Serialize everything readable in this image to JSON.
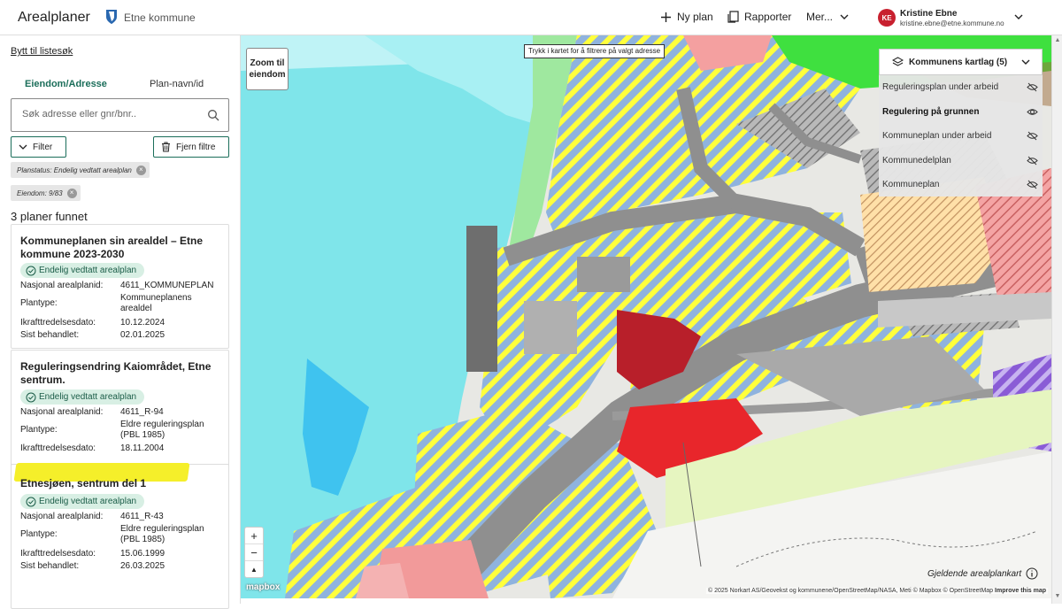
{
  "header": {
    "app_title": "Arealplaner",
    "municipality": "Etne kommune",
    "new_plan_label": "Ny plan",
    "reports_label": "Rapporter",
    "more_label": "Mer...",
    "user": {
      "initials": "KE",
      "name": "Kristine Ebne",
      "email": "kristine.ebne@etne.kommune.no"
    }
  },
  "sidebar": {
    "switch_link": "Bytt til listesøk",
    "tabs": [
      {
        "label": "Eiendom/Adresse",
        "active": true
      },
      {
        "label": "Plan-navn/id",
        "active": false
      }
    ],
    "search_placeholder": "Søk adresse eller gnr/bnr..",
    "filter_label": "Filter",
    "clear_filter_label": "Fjern filtre",
    "chips": [
      "Planstatus: Endelig vedtatt arealplan",
      "Eiendom: 9/83"
    ],
    "result_count": "3 planer funnet",
    "plans": [
      {
        "title": "Kommuneplanen sin arealdel – Etne kommune 2023-2030",
        "status": "Endelig vedtatt arealplan",
        "fields": [
          {
            "key": "Nasjonal arealplanid:",
            "value": "4611_KOMMUNEPLAN"
          },
          {
            "key": "Plantype:",
            "value": "Kommuneplanens arealdel"
          },
          {
            "key": "Ikrafttredelsesdato:",
            "value": "10.12.2024"
          },
          {
            "key": "Sist behandlet:",
            "value": "02.01.2025"
          }
        ]
      },
      {
        "title": "Reguleringsendring Kaiområdet, Etne sentrum.",
        "status": "Endelig vedtatt arealplan",
        "fields": [
          {
            "key": "Nasjonal arealplanid:",
            "value": "4611_R-94"
          },
          {
            "key": "Plantype:",
            "value": "Eldre reguleringsplan (PBL 1985)"
          },
          {
            "key": "Ikrafttredelsesdato:",
            "value": "18.11.2004"
          }
        ]
      },
      {
        "title": "Etnesjøen, sentrum del 1",
        "status": "Endelig vedtatt arealplan",
        "fields": [
          {
            "key": "Nasjonal arealplanid:",
            "value": "4611_R-43"
          },
          {
            "key": "Plantype:",
            "value": "Eldre reguleringsplan (PBL 1985)"
          },
          {
            "key": "Ikrafttredelsesdato:",
            "value": "15.06.1999"
          },
          {
            "key": "Sist behandlet:",
            "value": "26.03.2025"
          }
        ]
      }
    ]
  },
  "map": {
    "zoom_to_property": "Zoom til eiendom",
    "tooltip": "Trykk i kartet for å filtrere på valgt adresse",
    "layers_title": "Kommunens kartlag (5)",
    "layers": [
      {
        "label": "Reguleringsplan under arbeid",
        "visible": false
      },
      {
        "label": "Regulering på grunnen",
        "visible": true
      },
      {
        "label": "Kommuneplan under arbeid",
        "visible": false
      },
      {
        "label": "Kommunedelplan",
        "visible": false
      },
      {
        "label": "Kommuneplan",
        "visible": false
      }
    ],
    "legend_link": "Gjeldende arealplankart",
    "mapbox": "mapbox",
    "attribution": "© 2025 Norkart AS/Geovekst og kommunene/OpenStreetMap/NASA, Meti © Mapbox © OpenStreetMap",
    "improve": "Improve this map",
    "zoom_in": "+",
    "zoom_out": "−",
    "compass": "▲",
    "colors": {
      "water": "#7fe5ea",
      "sea_blue": "#3fc3ef",
      "road": "#8f8f8f",
      "hatch_blue": "#8fb3de",
      "hatch_yellow": "#ffff3c",
      "red_area": "#e8262b",
      "green": "#3fe03f",
      "pink": "#f29a9a"
    }
  }
}
